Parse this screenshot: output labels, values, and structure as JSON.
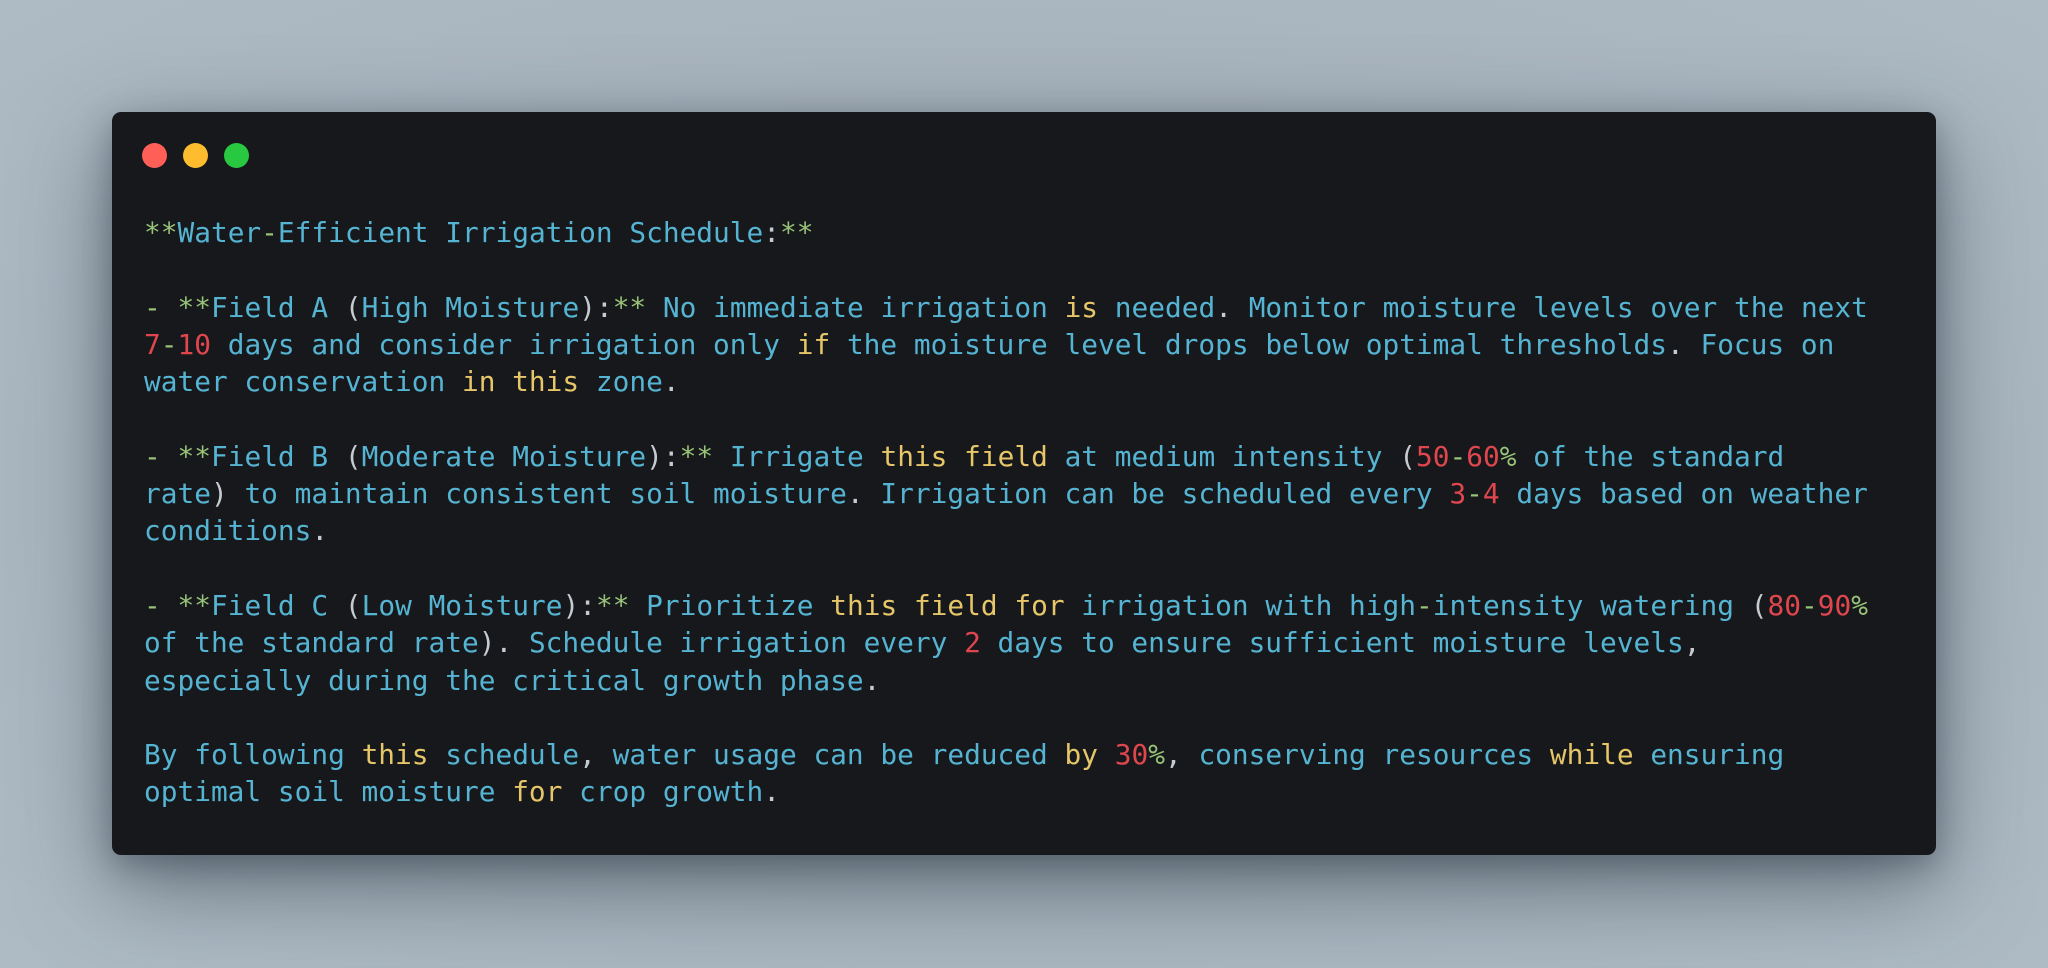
{
  "window": {
    "controls": [
      {
        "name": "close",
        "color": "#ff5f57"
      },
      {
        "name": "minimize",
        "color": "#febc2e"
      },
      {
        "name": "maximize",
        "color": "#28c840"
      }
    ],
    "background": "#16181b"
  },
  "palette": {
    "text": "#56b4d3",
    "markup": "#98c379",
    "punctuation": "#c6cbd1",
    "number": "#e0464e",
    "keyword": "#e6c668"
  },
  "lines": [
    [
      [
        "**",
        "mark"
      ],
      [
        "Water",
        "text"
      ],
      [
        "-",
        "mark"
      ],
      [
        "Efficient Irrigation Schedule",
        "text"
      ],
      [
        ":",
        "punct"
      ],
      [
        "**",
        "mark"
      ]
    ],
    [],
    [
      [
        "-",
        "mark"
      ],
      [
        " ",
        "text"
      ],
      [
        "**",
        "mark"
      ],
      [
        "Field A ",
        "text"
      ],
      [
        "(",
        "punct"
      ],
      [
        "High Moisture",
        "text"
      ],
      [
        ")",
        "punct"
      ],
      [
        ":",
        "punct"
      ],
      [
        "**",
        "mark"
      ],
      [
        " No immediate irrigation ",
        "text"
      ],
      [
        "is",
        "kw"
      ],
      [
        " needed",
        "text"
      ],
      [
        ".",
        "punct"
      ],
      [
        " Monitor moisture levels over the next",
        "text"
      ]
    ],
    [
      [
        "7",
        "num"
      ],
      [
        "-",
        "mark"
      ],
      [
        "10",
        "num"
      ],
      [
        " days and consider irrigation only ",
        "text"
      ],
      [
        "if",
        "kw"
      ],
      [
        " the moisture level drops below optimal thresholds",
        "text"
      ],
      [
        ".",
        "punct"
      ],
      [
        " Focus on",
        "text"
      ]
    ],
    [
      [
        "water conservation ",
        "text"
      ],
      [
        "in this",
        "kw"
      ],
      [
        " zone",
        "text"
      ],
      [
        ".",
        "punct"
      ]
    ],
    [],
    [
      [
        "-",
        "mark"
      ],
      [
        " ",
        "text"
      ],
      [
        "**",
        "mark"
      ],
      [
        "Field B ",
        "text"
      ],
      [
        "(",
        "punct"
      ],
      [
        "Moderate Moisture",
        "text"
      ],
      [
        ")",
        "punct"
      ],
      [
        ":",
        "punct"
      ],
      [
        "**",
        "mark"
      ],
      [
        " Irrigate ",
        "text"
      ],
      [
        "this field",
        "kw"
      ],
      [
        " at medium intensity ",
        "text"
      ],
      [
        "(",
        "punct"
      ],
      [
        "50",
        "num"
      ],
      [
        "-",
        "mark"
      ],
      [
        "60",
        "num"
      ],
      [
        "%",
        "mark"
      ],
      [
        " of the standard",
        "text"
      ]
    ],
    [
      [
        "rate",
        "text"
      ],
      [
        ")",
        "punct"
      ],
      [
        " to maintain consistent soil moisture",
        "text"
      ],
      [
        ".",
        "punct"
      ],
      [
        " Irrigation can be scheduled every ",
        "text"
      ],
      [
        "3",
        "num"
      ],
      [
        "-",
        "mark"
      ],
      [
        "4",
        "num"
      ],
      [
        " days based on weather",
        "text"
      ]
    ],
    [
      [
        "conditions",
        "text"
      ],
      [
        ".",
        "punct"
      ]
    ],
    [],
    [
      [
        "-",
        "mark"
      ],
      [
        " ",
        "text"
      ],
      [
        "**",
        "mark"
      ],
      [
        "Field C ",
        "text"
      ],
      [
        "(",
        "punct"
      ],
      [
        "Low Moisture",
        "text"
      ],
      [
        ")",
        "punct"
      ],
      [
        ":",
        "punct"
      ],
      [
        "**",
        "mark"
      ],
      [
        " Prioritize ",
        "text"
      ],
      [
        "this field for",
        "kw"
      ],
      [
        " irrigation with high",
        "text"
      ],
      [
        "-",
        "mark"
      ],
      [
        "intensity watering ",
        "text"
      ],
      [
        "(",
        "punct"
      ],
      [
        "80",
        "num"
      ],
      [
        "-",
        "mark"
      ],
      [
        "90",
        "num"
      ],
      [
        "%",
        "mark"
      ]
    ],
    [
      [
        "of the standard rate",
        "text"
      ],
      [
        ")",
        "punct"
      ],
      [
        ".",
        "punct"
      ],
      [
        " Schedule irrigation every ",
        "text"
      ],
      [
        "2",
        "num"
      ],
      [
        " days to ensure sufficient moisture levels",
        "text"
      ],
      [
        ",",
        "punct"
      ]
    ],
    [
      [
        "especially during the critical growth phase",
        "text"
      ],
      [
        ".",
        "punct"
      ]
    ],
    [],
    [
      [
        "By following ",
        "text"
      ],
      [
        "this",
        "kw"
      ],
      [
        " schedule",
        "text"
      ],
      [
        ",",
        "punct"
      ],
      [
        " water usage can be reduced ",
        "text"
      ],
      [
        "by",
        "kw"
      ],
      [
        " ",
        "text"
      ],
      [
        "30",
        "num"
      ],
      [
        "%",
        "mark"
      ],
      [
        ",",
        "punct"
      ],
      [
        " conserving resources ",
        "text"
      ],
      [
        "while",
        "kw"
      ],
      [
        " ensuring",
        "text"
      ]
    ],
    [
      [
        "optimal soil moisture ",
        "text"
      ],
      [
        "for",
        "kw"
      ],
      [
        " crop growth",
        "text"
      ],
      [
        ".",
        "punct"
      ]
    ]
  ]
}
